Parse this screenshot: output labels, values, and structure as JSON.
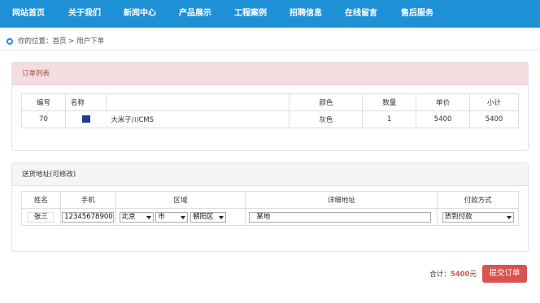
{
  "nav": [
    "网站首页",
    "关于我们",
    "新闻中心",
    "产品展示",
    "工程案例",
    "招聘信息",
    "在线留言",
    "售后服务"
  ],
  "breadcrumb": {
    "prefix": "你的位置：",
    "home": "首页",
    "sep": ">",
    "current": "用户下单"
  },
  "order": {
    "title": "订单列表",
    "headers": [
      "编号",
      "名称",
      "",
      "颜色",
      "数量",
      "单价",
      "小计"
    ],
    "row": {
      "id": "70",
      "name": "大米子川CMS",
      "color": "灰色",
      "qty": "1",
      "price": "5400",
      "subtotal": "5400"
    }
  },
  "address": {
    "title": "送货地址(可修改)",
    "headers": [
      "姓名",
      "手机",
      "区域",
      "详细地址",
      "付款方式"
    ],
    "name": "张三",
    "phone": "12345678900",
    "province": "北京",
    "city": "市",
    "district": "朝阳区",
    "detail": "某地",
    "payment": "货到付款"
  },
  "total": {
    "label": "合计：",
    "value": "5400",
    "unit": "元"
  },
  "submit_label": "提交订单",
  "colors": {
    "nav_bg": "#1e90d6",
    "danger": "#d9534f",
    "order_head_bg": "#f2dede"
  }
}
